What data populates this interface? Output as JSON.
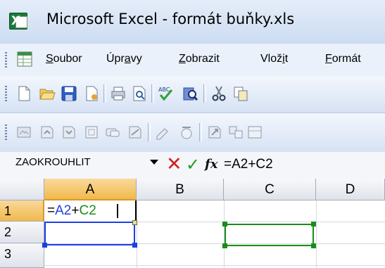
{
  "window": {
    "title": "Microsoft Excel - formát buňky.xls",
    "app_icon": "excel-icon"
  },
  "menubar": {
    "items": [
      {
        "label_pre": "",
        "accel": "S",
        "label_post": "oubor"
      },
      {
        "label_pre": "Úpr",
        "accel": "a",
        "label_post": "vy"
      },
      {
        "label_pre": "",
        "accel": "Z",
        "label_post": "obrazit"
      },
      {
        "label_pre": "Vlož",
        "accel": "i",
        "label_post": "t"
      },
      {
        "label_pre": "",
        "accel": "F",
        "label_post": "ormát"
      }
    ]
  },
  "toolbar_standard": {
    "icons": [
      "new-icon",
      "open-icon",
      "save-icon",
      "permission-icon",
      "print-icon",
      "print-preview-icon",
      "spelling-icon",
      "research-icon",
      "cut-icon",
      "copy-icon"
    ]
  },
  "toolbar_secondary": {
    "icons": [
      "toolbar-icon-1",
      "toolbar-icon-2",
      "toolbar-icon-3",
      "toolbar-icon-4",
      "toolbar-icon-5",
      "toolbar-icon-6",
      "toolbar-icon-7",
      "toolbar-icon-8",
      "toolbar-icon-9",
      "toolbar-icon-10",
      "toolbar-icon-11"
    ]
  },
  "formula_bar": {
    "name_box": "ZAOKROUHLIT",
    "cancel_symbol": "✕",
    "enter_symbol": "✓",
    "fx_label": "fx",
    "content": "=A2+C2"
  },
  "grid": {
    "columns": [
      "A",
      "B",
      "C",
      "D"
    ],
    "rows": [
      "1",
      "2",
      "3"
    ],
    "active_column": "A",
    "active_row": "1",
    "editing_cell": {
      "ref": "A1",
      "parts": [
        {
          "text": "=",
          "color": "#000000"
        },
        {
          "text": "A2",
          "color": "#1f3fe0"
        },
        {
          "text": "+",
          "color": "#000000"
        },
        {
          "text": "C2",
          "color": "#1a8c1a"
        }
      ]
    },
    "reference_highlights": [
      {
        "ref": "A2",
        "color": "#1f3fe0"
      },
      {
        "ref": "C2",
        "color": "#1a8c1a"
      }
    ]
  }
}
